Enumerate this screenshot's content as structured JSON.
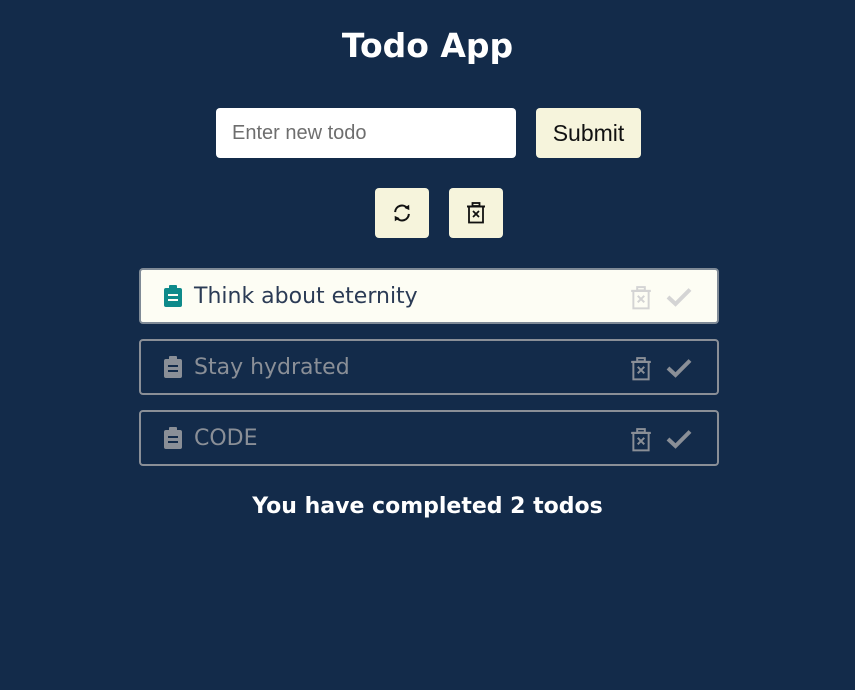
{
  "app": {
    "title": "Todo App"
  },
  "form": {
    "input_placeholder": "Enter new todo",
    "input_value": "",
    "submit_label": "Submit"
  },
  "toolbar": {
    "refresh_icon": "refresh-icon",
    "clear_icon": "delete-all-icon"
  },
  "todos": [
    {
      "text": "Think about eternity",
      "completed": false,
      "icon": "clipboard-icon",
      "icon_color": "#0e8a8a"
    },
    {
      "text": "Stay hydrated",
      "completed": true,
      "icon": "clipboard-icon",
      "icon_color": "#8a8f97"
    },
    {
      "text": "CODE",
      "completed": true,
      "icon": "clipboard-icon",
      "icon_color": "#8a8f97"
    }
  ],
  "footer": {
    "status": "You have completed 2 todos"
  },
  "colors": {
    "background": "#132b4a",
    "button_bg": "#f6f4dc",
    "active_item_bg": "#fdfdf4",
    "accent": "#0e8a8a",
    "muted": "#8a8f97"
  }
}
